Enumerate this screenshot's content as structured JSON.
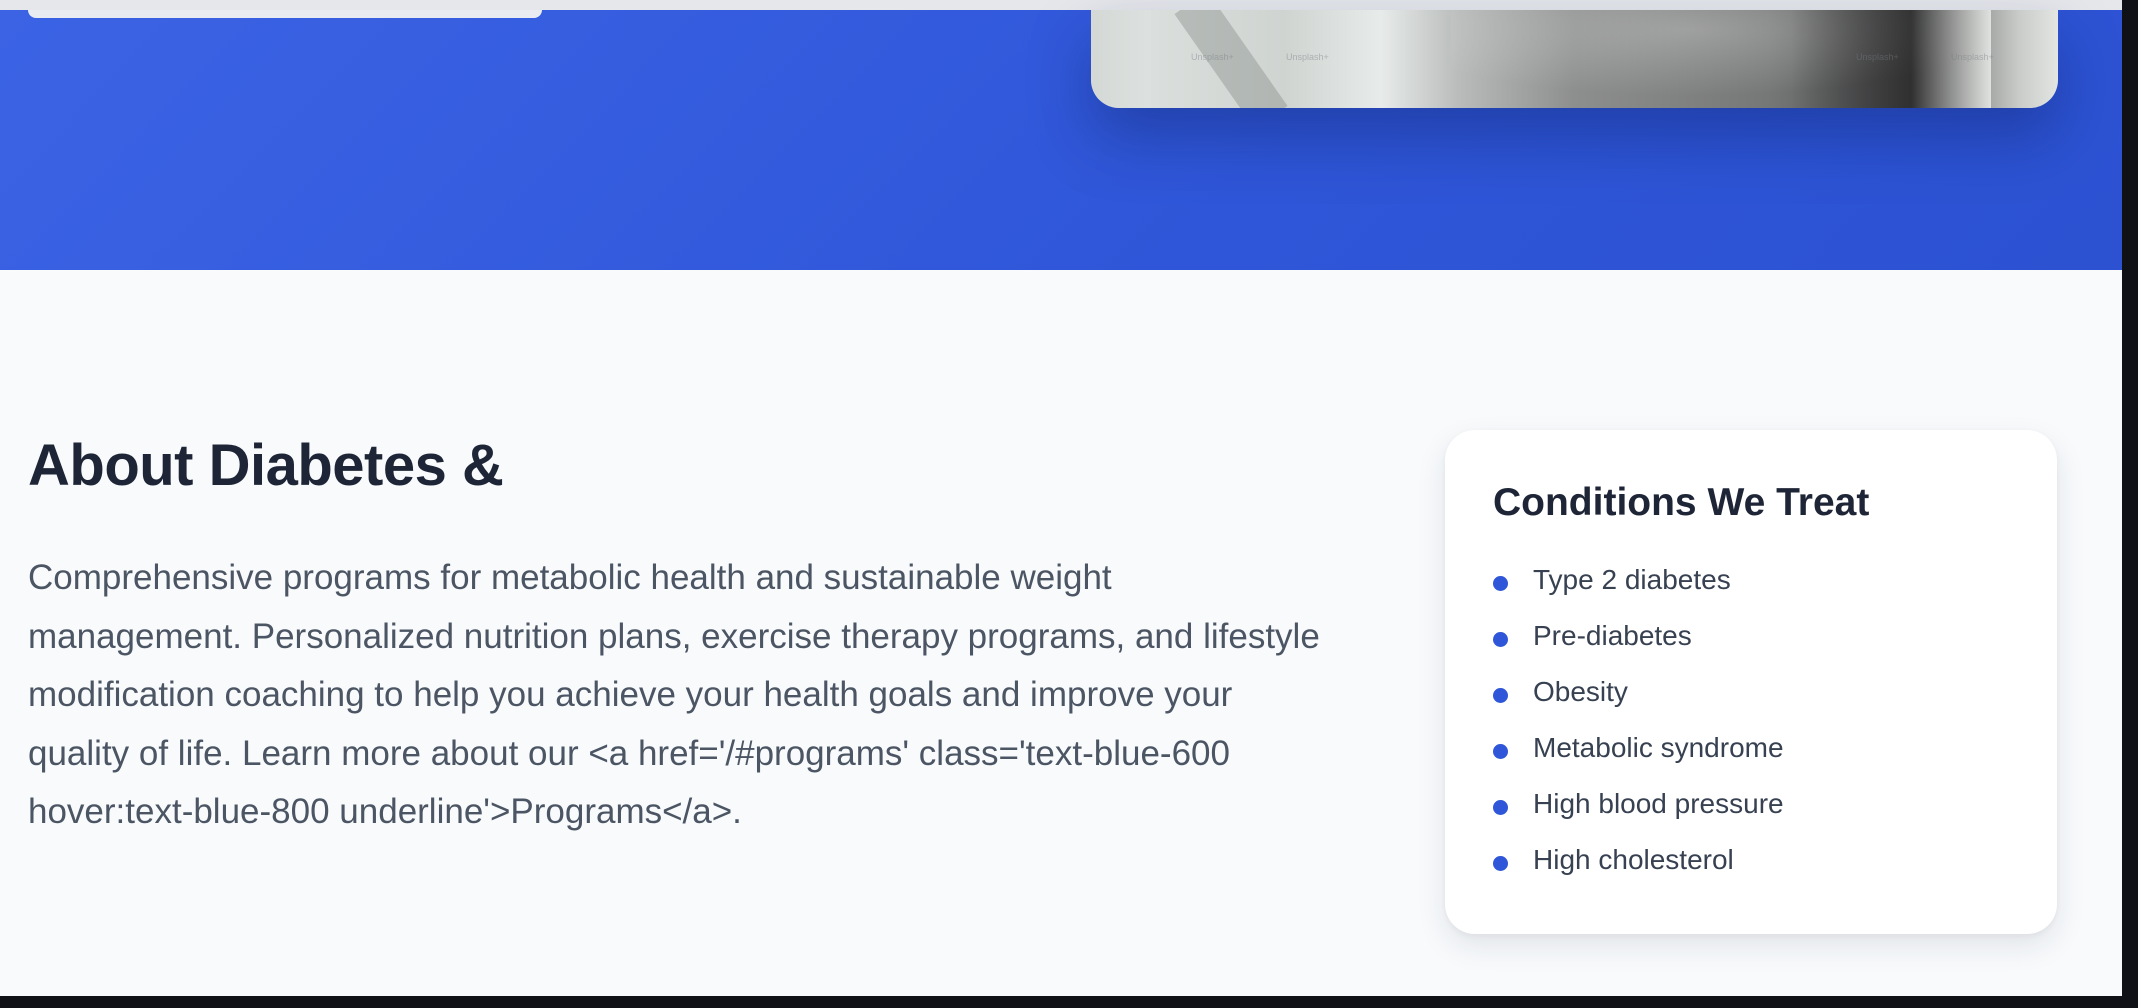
{
  "hero": {
    "image_watermarks": [
      "Unsplash+",
      "Unsplash+",
      "Unsplash+",
      "Unsplash+"
    ]
  },
  "about": {
    "title": "About Diabetes &",
    "description": "Comprehensive programs for metabolic health and sustainable weight management. Personalized nutrition plans, exercise therapy programs, and lifestyle modification coaching to help you achieve your health goals and improve your quality of life. Learn more about our <a href='/#programs' class='text-blue-600 hover:text-blue-800 underline'>Programs</a>."
  },
  "conditions": {
    "title": "Conditions We Treat",
    "items": [
      {
        "label": "Type 2 diabetes"
      },
      {
        "label": "Pre-diabetes"
      },
      {
        "label": "Obesity"
      },
      {
        "label": "Metabolic syndrome"
      },
      {
        "label": "High blood pressure"
      },
      {
        "label": "High cholesterol"
      }
    ]
  },
  "colors": {
    "hero_blue": "#3b63e4",
    "accent_dot": "#2f56d8",
    "heading": "#1e2536",
    "body_text": "#4b5563",
    "page_bg": "#f8fafc"
  }
}
